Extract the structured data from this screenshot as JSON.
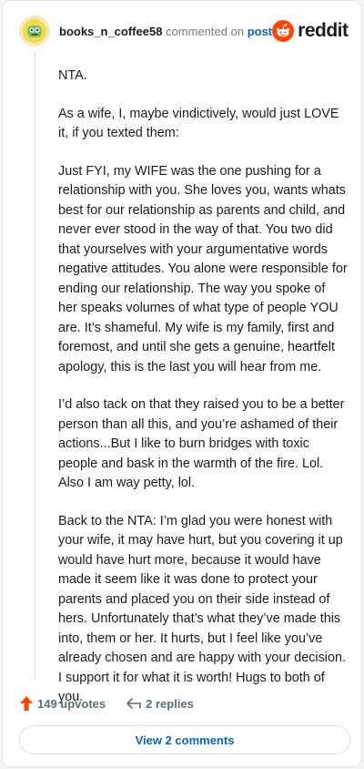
{
  "comment": {
    "username": "books_n_coffee58",
    "action_text": "commented on",
    "post_link": "post",
    "brand": "reddit",
    "paragraphs": [
      "NTA.",
      "As a wife, I, maybe vindictively, would just LOVE it, if you texted them:",
      "Just FYI, my WIFE was the one pushing for a relationship with you. She loves you, wants whats best for our relationship as parents and child, and never ever stood in the way of that. You two did that yourselves with your argumentative words negative attitudes. You alone were responsible for ending our relationship. The way you spoke of her speaks volumes of what type of people YOU are. It’s shameful. My wife is my family, first and foremost, and until she gets a genuine, heartfelt apology, this is the last you will hear from me.",
      "I’d also tack on that they raised you to be a better person than all this, and you’re ashamed of their actions...But I like to burn bridges with toxic people and bask in the warmth of the fire. Lol. Also I am way petty, lol.",
      "Back to the NTA: I’m glad you were honest with your wife, it may have hurt, but you covering it up would have hurt more, because it would have made it seem like it was done to protect your parents and placed you on their side instead of hers. Unfortunately that’s what they’ve made this into, them or her. It hurts, but I feel like you’ve already chosen and are happy with your decision. I support it for what it is worth! Hugs to both of you."
    ],
    "upvotes_label": "149 upvotes",
    "replies_label": "2 replies",
    "view_comments_label": "View 2 comments"
  },
  "icons": {
    "avatar": "avatar-icon",
    "logo": "reddit-alien-icon",
    "upvote": "upvote-arrow-icon",
    "reply": "reply-arrow-icon"
  },
  "colors": {
    "upvote": "#ff4500",
    "link": "#0a66c2",
    "brand": "#ff4500",
    "meta_text": "#576f76"
  }
}
